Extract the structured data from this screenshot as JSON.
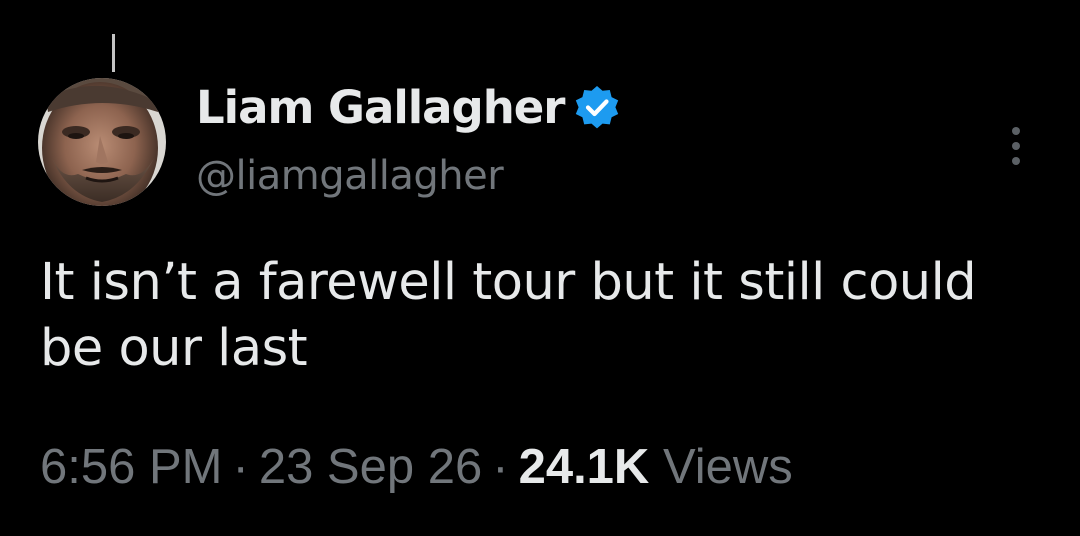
{
  "tweet": {
    "author": {
      "display_name": "Liam Gallagher",
      "handle": "@liamgallagher",
      "verified": true,
      "verified_color": "#1d9bf0"
    },
    "text": "It isn’t a farewell tour but it still could be our last",
    "time": "6:56 PM",
    "separator": "·",
    "date": "23 Sep 26",
    "views_count": "24.1K",
    "views_label": "Views"
  },
  "icons": {
    "verified": "verified-badge-icon",
    "more": "more-options-icon"
  },
  "theme": {
    "background": "#000000",
    "primary_text": "#e7e9ea",
    "secondary_text": "#71767b"
  }
}
